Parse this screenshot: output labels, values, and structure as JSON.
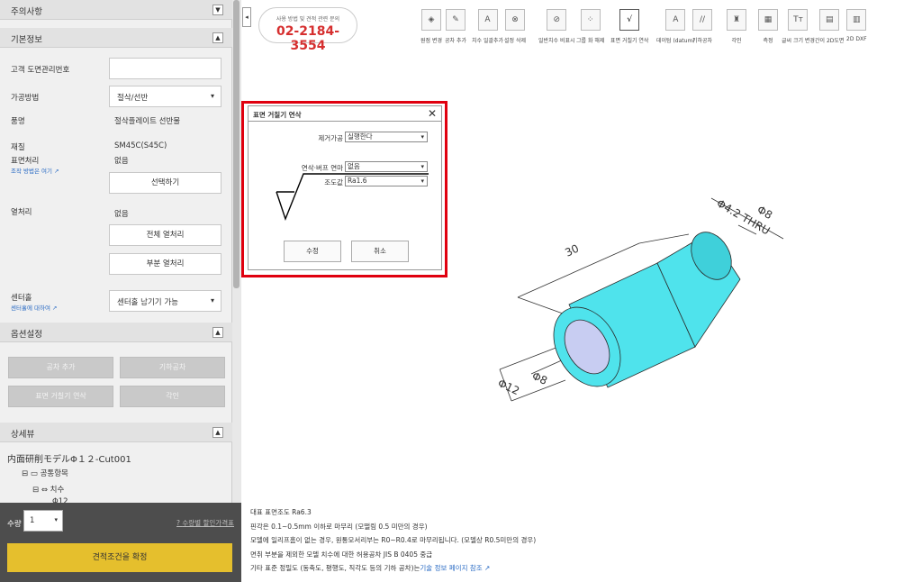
{
  "left_panel": {
    "notes_header": "주의사항",
    "basic_header": "기본정보",
    "drawing_no_label": "고객 도면관리번호",
    "drawing_no_value": "",
    "process_label": "가공방법",
    "process_value": "절삭/선반",
    "product_label": "품명",
    "product_value": "절삭플레이트 선반물",
    "material_label": "재질",
    "material_value": "SM45C(S45C)",
    "surface_label": "표면처리",
    "surface_value": "없음",
    "surface_link": "조작 방법은 여기",
    "select_button": "선택하기",
    "heat_label": "열처리",
    "heat_value": "없음",
    "heat_all_button": "전체 열처리",
    "heat_part_button": "부분 열처리",
    "center_label": "센터홀",
    "center_link": "센터홀에 대하여",
    "center_value": "센터홀 남기기 가능",
    "option_header": "옵션설정",
    "option_buttons": [
      "공차 추가",
      "기하공차",
      "표면 거칠기 연삭",
      "각인"
    ],
    "detail_header": "상세뷰",
    "tree_root": "内面研削モデルΦ１２-Cut001",
    "tree_items": [
      "공통항목",
      "치수",
      "Φ12"
    ]
  },
  "bottom": {
    "qty_label": "수량",
    "qty_value": "1",
    "qty_help": "수량별 할인가격표",
    "confirm_button": "견적조건을 확정"
  },
  "phone": {
    "sub": "사용 방법 및 견적 관련 문의",
    "number": "02-2184-3554"
  },
  "toolbar": [
    {
      "label": "원점 변경",
      "icon": "origin-icon"
    },
    {
      "label": "공차 추가",
      "icon": "pencil-icon"
    },
    {
      "label": "치수 일괄추가",
      "icon": "dimension-icon"
    },
    {
      "label": "설정 삭제",
      "icon": "delete-icon"
    },
    {
      "label": "일반치수 비표시",
      "icon": "hide-icon"
    },
    {
      "label": "그룹 화 해제",
      "icon": "ungroup-icon"
    },
    {
      "label": "표면 거칠기 연삭",
      "icon": "roughness-icon"
    },
    {
      "label": "데이텀 (datum)",
      "icon": "datum-icon"
    },
    {
      "label": "기하공차",
      "icon": "geometric-icon"
    },
    {
      "label": "각인",
      "icon": "stamp-icon"
    },
    {
      "label": "측정",
      "icon": "measure-icon"
    },
    {
      "label": "글씨 크기 변경",
      "icon": "text-size-icon"
    },
    {
      "label": "간이 2D도면",
      "icon": "2d-drawing-icon"
    },
    {
      "label": "2D DXF",
      "icon": "dxf-icon"
    }
  ],
  "dialog": {
    "title": "표면 거칠기 연삭",
    "removal_label": "제거가공",
    "removal_value": "실행한다",
    "grind_label": "연삭·버프 연마",
    "grind_value": "없음",
    "roughness_label": "조도값",
    "roughness_value": "Ra1.6",
    "ok_button": "수정",
    "cancel_button": "취소"
  },
  "drawing": {
    "dim_length": "30",
    "dim_d8_top": "Φ8",
    "dim_d42_thru": "Φ4.2 THRU",
    "dim_d8_bottom": "Φ8",
    "dim_d12": "Φ12"
  },
  "notes": [
    "대표 표면조도 Ra6.3",
    "핀각은 0.1~0.5mm 이하로 마무리 (모떨림 0.5 미만의 경우)",
    "모델에 일리프홈이 없는 경우, 원통모서리부는 R0~R0.4로 마무리됩니다. (모델상 R0.5미만의 경우)",
    "면취 부분을 제외한 모델 치수에 대한 허용공차 JIS B 0405 중급",
    "기타 표준 정밀도 (동축도, 평행도, 직각도 등의 기하 공차)는"
  ],
  "notes_link": "기술 정보 페이지 참조",
  "colors": {
    "accent_red": "#d62f2f",
    "confirm_yellow": "#e5bf2d",
    "cylinder": "#4fe3ec"
  }
}
